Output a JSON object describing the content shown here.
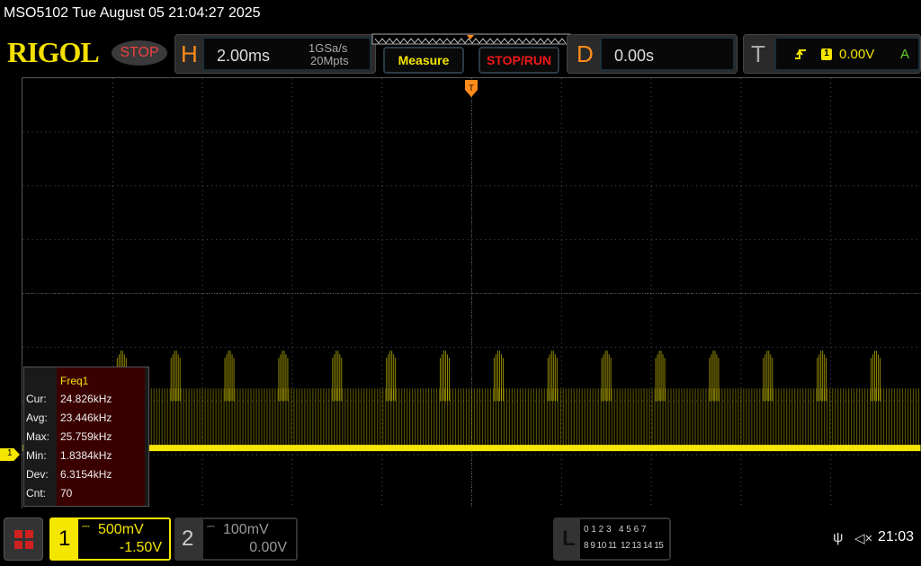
{
  "title": "MSO5102  Tue August 05 21:04:27 2025",
  "brand": "RIGOL",
  "run_state": "STOP",
  "horizontal": {
    "letter": "H",
    "timebase": "2.00ms",
    "sample_rate": "1GSa/s",
    "memory_depth": "20Mpts"
  },
  "buttons": {
    "measure": "Measure",
    "stop_run": "STOP/RUN"
  },
  "delay": {
    "letter": "D",
    "value": "0.00s"
  },
  "trigger": {
    "letter": "T",
    "source": "1",
    "level": "0.00V",
    "mode": "A",
    "slope_icon": "rising-edge-icon"
  },
  "measurement": {
    "name": "Freq1",
    "rows": [
      {
        "label": "Cur:",
        "value": "24.826kHz"
      },
      {
        "label": "Avg:",
        "value": "23.446kHz"
      },
      {
        "label": "Max:",
        "value": "25.759kHz"
      },
      {
        "label": "Min:",
        "value": "1.8384kHz"
      },
      {
        "label": "Dev:",
        "value": "6.3154kHz"
      },
      {
        "label": "Cnt:",
        "value": "70"
      }
    ]
  },
  "channels": [
    {
      "number": "1",
      "scale": "500mV",
      "offset": "-1.50V",
      "color": "#f5e600",
      "active": true
    },
    {
      "number": "2",
      "scale": "100mV",
      "offset": "0.00V",
      "color": "#888888",
      "active": false
    }
  ],
  "channel_marker": "1",
  "logic": {
    "letter": "L",
    "row1": "0 1 2 3   4 5 6 7",
    "row2": "8 9 10 11  12 13 14 15"
  },
  "status": {
    "time": "21:03",
    "usb_icon": "usb-icon",
    "sound_icon": "speaker-muted-icon"
  },
  "colors": {
    "accent_orange": "#ff8c1a",
    "ch1": "#f5e600",
    "stop_red": "#f04040"
  }
}
